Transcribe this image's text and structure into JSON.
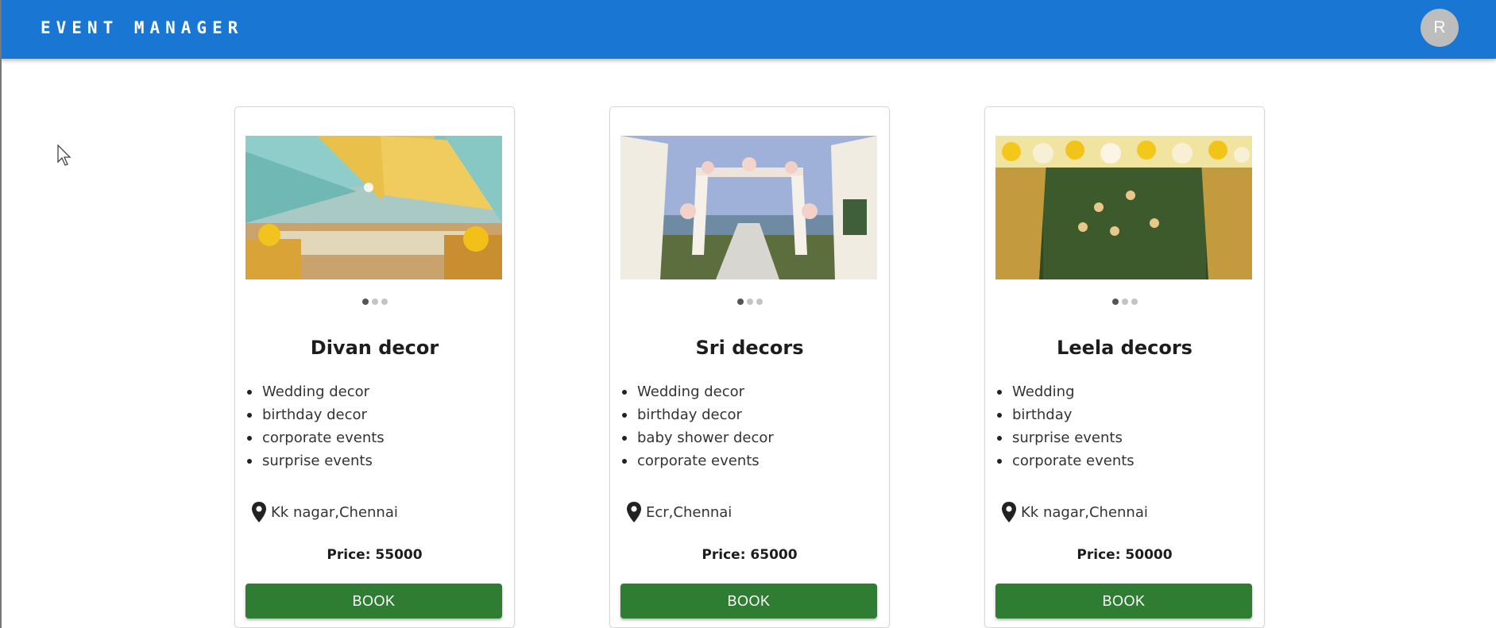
{
  "app": {
    "title": "EVENT MANAGER",
    "avatar_initial": "R"
  },
  "cards": [
    {
      "name": "Divan decor",
      "image_alt": "Wedding hall with teal and yellow draped ceiling",
      "features": [
        "Wedding decor",
        "birthday decor",
        "corporate events",
        "surprise events"
      ],
      "location": "Kk nagar,Chennai",
      "price": "Price: 55000",
      "book_label": "BOOK",
      "active_slide": 0,
      "slide_count": 3
    },
    {
      "name": "Sri decors",
      "image_alt": "White draped outdoor wedding mandap with flower aisle",
      "features": [
        "Wedding decor",
        "birthday decor",
        "baby shower decor",
        "corporate events"
      ],
      "location": "Ecr,Chennai",
      "price": "Price: 65000",
      "book_label": "BOOK",
      "active_slide": 0,
      "slide_count": 3
    },
    {
      "name": "Leela decors",
      "image_alt": "Floral backdrop with golden curtains and green wall",
      "features": [
        "Wedding",
        "birthday",
        "surprise events",
        "corporate events"
      ],
      "location": "Kk nagar,Chennai",
      "price": "Price: 50000",
      "book_label": "BOOK",
      "active_slide": 0,
      "slide_count": 3
    }
  ],
  "colors": {
    "appbar": "#1976d2",
    "book_button": "#2e7d32",
    "avatar": "#bdbdbd"
  },
  "icons": {
    "location": "location-pin-icon",
    "cursor": "mouse-pointer-icon"
  }
}
